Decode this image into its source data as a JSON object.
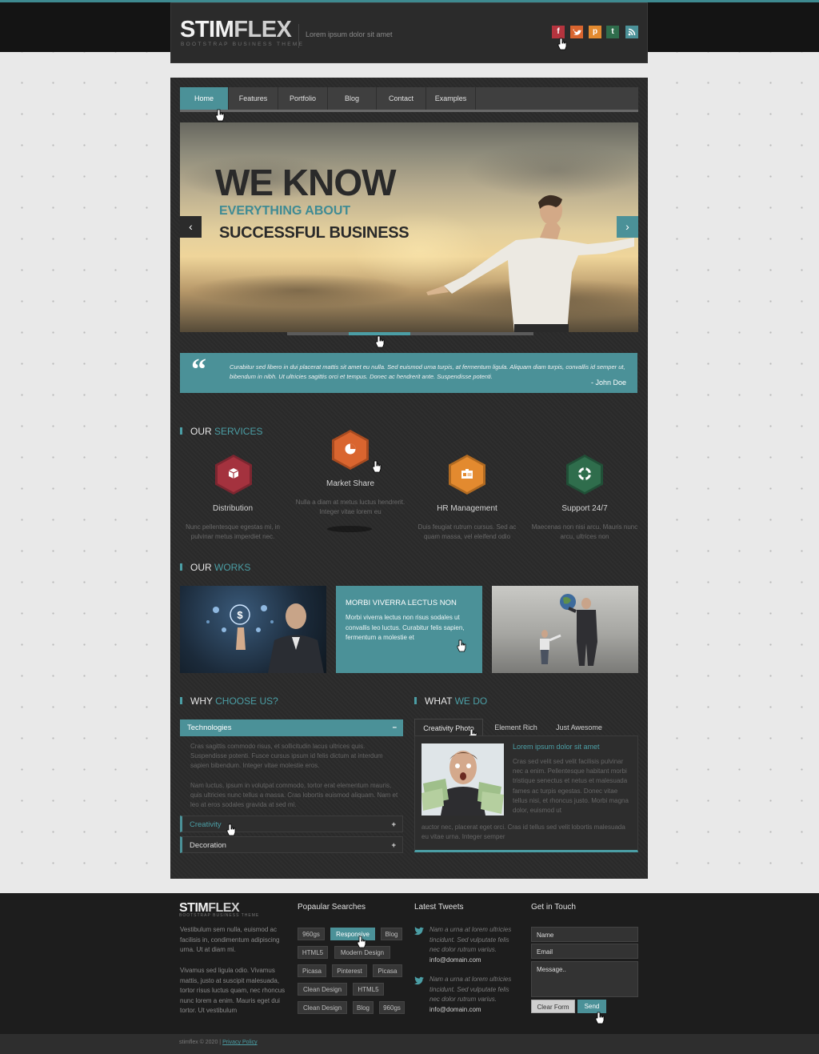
{
  "header": {
    "logo_stim": "STIM",
    "logo_flex": "FLEX",
    "logo_sub": "BOOTSTRAP BUSINESS THEME",
    "tagline": "Lorem ipsum dolor sit amet",
    "social": [
      "f",
      "t",
      "p",
      "t",
      "rss"
    ]
  },
  "nav": {
    "items": [
      "Home",
      "Features",
      "Portfolio",
      "Blog",
      "Contact",
      "Examples"
    ],
    "active": "Home"
  },
  "slider": {
    "h1": "WE KNOW",
    "h2": "EVERYTHING ABOUT",
    "h3": "SUCCESSFUL BUSINESS",
    "prev": "‹",
    "next": "›"
  },
  "quote": {
    "mark": "“",
    "text": "Curabitur sed libero in dui placerat mattis sit amet eu nulla. Sed euismod urna turpis, at fermentum ligula. Aliquam diam turpis, convallis id semper ut, bibendum in nibh. Ut ultricies sagittis orci et tempus. Donec ac hendrerit ante. Suspendisse potenti.",
    "author": "- John Doe"
  },
  "services": {
    "title_a": "OUR",
    "title_b": "SERVICES",
    "items": [
      {
        "title": "Distribution",
        "desc": "Nunc pellentesque egestas mi, in pulvinar metus imperdiet nec.",
        "icon": "cube-icon",
        "color": "#a4323e"
      },
      {
        "title": "Market Share",
        "desc": "Nulla a diam at metus luctus hendrerit. Integer vitae lorem eu",
        "icon": "pie-chart-icon",
        "color": "#d9652f"
      },
      {
        "title": "HR Management",
        "desc": "Duis feugiat rutrum cursus. Sed ac quam massa, vel eleifend odio",
        "icon": "id-card-icon",
        "color": "#e38a2f"
      },
      {
        "title": "Support 24/7",
        "desc": "Maecenas non nisi arcu. Mauris nunc arcu, ultrices non",
        "icon": "lifebuoy-icon",
        "color": "#2f6d4c"
      }
    ]
  },
  "works": {
    "title_a": "OUR",
    "title_b": "WORKS",
    "card_title": "MORBI VIVERRA LECTUS NON",
    "card_text": "Morbi viverra lectus non risus sodales ut convallis leo luctus. Curabitur felis sapien, fermentum a molestie et"
  },
  "why": {
    "title_a": "WHY",
    "title_b": "CHOOSE US?",
    "open_label": "Technologies",
    "open_toggle": "−",
    "para1": "Cras sagittis commodo risus, et sollicitudin lacus ultrices quis. Suspendisse potenti. Fusce cursus ipsum id felis dictum at interdum sapien bibendum. Integer vitae molestie eros.",
    "para2": "Nam luctus, ipsum in volutpat commodo, tortor erat elementum mauris, quis ultricies nunc tellus a massa. Cras lobortis euismod aliquam. Nam et leo at eros sodales gravida at sed mi.",
    "closed": [
      {
        "label": "Creativity",
        "toggle": "+"
      },
      {
        "label": "Decoration",
        "toggle": "+"
      }
    ]
  },
  "whatwedo": {
    "title_a": "WHAT",
    "title_b": "WE DO",
    "tabs": [
      "Creativity Photo",
      "Element Rich",
      "Just Awesome"
    ],
    "active_tab": "Creativity Photo",
    "heading": "Lorem ipsum dolor sit amet",
    "text1": "Cras sed velit sed velit facilisis pulvinar nec a enim. Pellentesque habitant morbi tristique senectus et netus et malesuada fames ac turpis egestas. Donec vitae tellus nisi, et rhoncus justo. Morbi magna dolor, euismod ut",
    "text2": "auctor nec, placerat eget orci. Cras id tellus sed velit lobortis malesuada eu vitae urna. Integer semper"
  },
  "footer": {
    "logo_stim": "STIM",
    "logo_flex": "FLEX",
    "logo_sub": "BOOTSTRAP BUSINESS THEME",
    "about1": "Vestibulum sem nulla, euismod ac facilisis in, condimentum adipiscing urna. Ut at diam mi.",
    "about2": "Vivamus sed ligula odio. Vivamus mattis, justo at suscipit malesuada, tortor risus luctus quam, nec rhoncus nunc lorem a enim. Mauris eget dui tortor. Ut vestibulum",
    "searches_title": "Popaular Searches",
    "tags": [
      "960gs",
      "Responsive",
      "Blog",
      "HTML5",
      "Modern Design",
      "Picasa",
      "Pinterest",
      "Picasa",
      "Clean Design",
      "HTML5",
      "Clean Design",
      "Blog",
      "960gs"
    ],
    "active_tag": "Responsive",
    "tweets_title": "Latest Tweets",
    "tweets": [
      {
        "text": "Nam a urna at lorem ultricies tincidunt. Sed vulputate felis nec dolor rutrum varius.",
        "email": "info@domain.com"
      },
      {
        "text": "Nam a urna at lorem ultricies tincidunt. Sed vulputate felis nec dolor rutrum varius.",
        "email": "info@domain.com"
      }
    ],
    "contact_title": "Get in Touch",
    "name_placeholder": "Name",
    "email_placeholder": "Email",
    "message_placeholder": "Message..",
    "clear_label": "Clear Form",
    "send_label": "Send",
    "copyright": "stimflex © 2020 |",
    "privacy": "Privacy Policy"
  },
  "colors": {
    "accent": "#4b9198",
    "dark": "#2a2a2a",
    "topbar": "#141414"
  }
}
